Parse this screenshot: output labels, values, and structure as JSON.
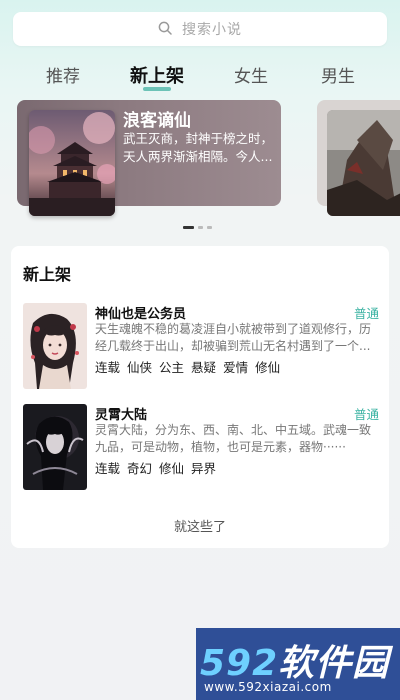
{
  "search": {
    "placeholder": "搜索小说",
    "icon": "search-icon"
  },
  "tabs": [
    {
      "label": "推荐"
    },
    {
      "label": "新上架",
      "active": true
    },
    {
      "label": "女生"
    },
    {
      "label": "男生"
    }
  ],
  "carousel": {
    "featured": {
      "title": "浪客谪仙",
      "desc": "武王灭商，封神于榜之时，天人两界渐渐相隔。今人..."
    },
    "page_count": 3,
    "active_page": 1
  },
  "section": {
    "title": "新上架",
    "books": [
      {
        "name": "神仙也是公务员",
        "type": "普通",
        "desc": "天生魂魄不稳的葛凌涯自小就被带到了道观修行，历经几载终于出山，却被骗到荒山无名村遇到了一个...",
        "tags": [
          "连载",
          "仙侠",
          "公主",
          "悬疑",
          "爱情",
          "修仙"
        ]
      },
      {
        "name": "灵霄大陆",
        "type": "普通",
        "desc": "灵霄大陆，分为东、西、南、北、中五域。武魂一致九品，可是动物，植物，也可是元素，器物······",
        "tags": [
          "连载",
          "奇幻",
          "修仙",
          "异界"
        ]
      }
    ],
    "end_text": "就这些了"
  },
  "watermark": {
    "brand_num": "592",
    "brand_text": "软件园",
    "url": "www.592xiazai.com"
  },
  "colors": {
    "accent": "#3bb3a3",
    "underline": "#6dc3b7",
    "watermark_bg": "#2f4f97"
  }
}
